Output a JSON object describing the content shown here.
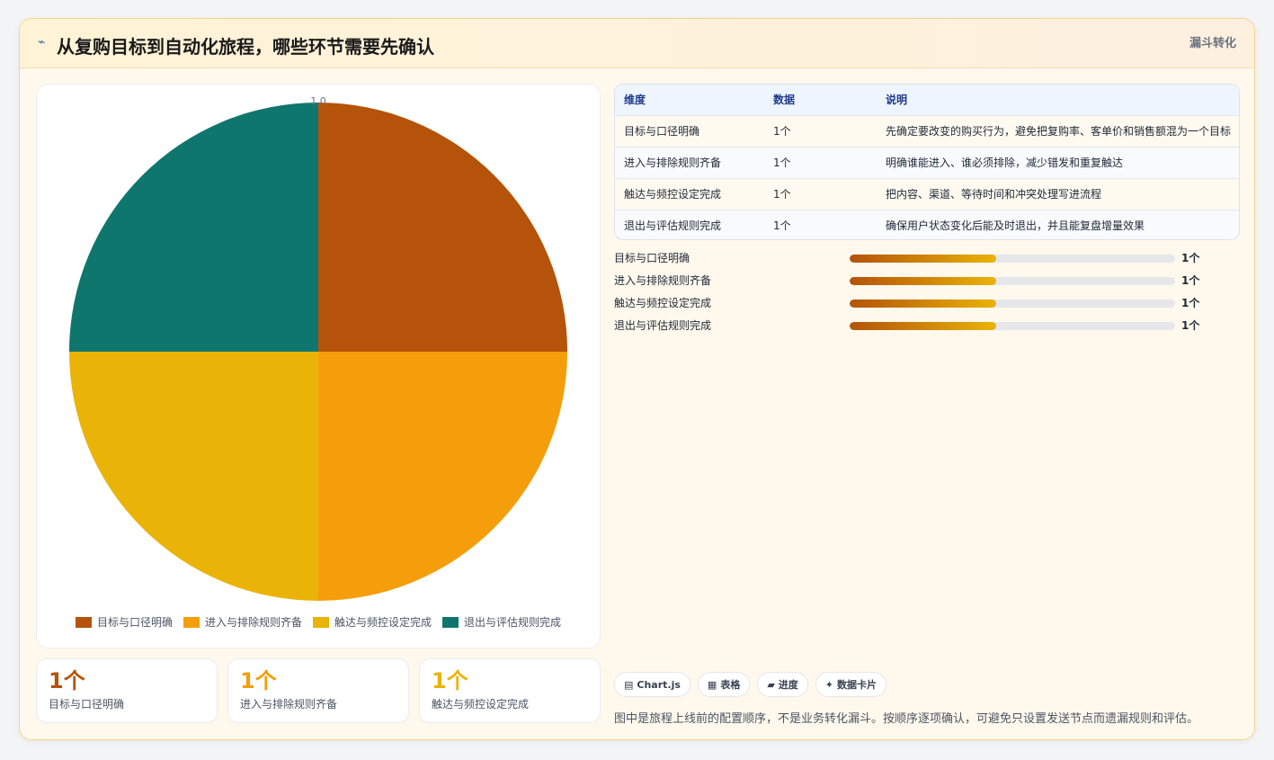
{
  "header": {
    "icon": "bolt-icon",
    "title": "从复购目标到自动化旅程，哪些环节需要先确认",
    "tag": "漏斗转化"
  },
  "chart_data": {
    "type": "pie",
    "categories": [
      "目标与口径明确",
      "进入与排除规则齐备",
      "触达与频控设定完成",
      "退出与评估规则完成"
    ],
    "values": [
      1,
      1,
      1,
      1
    ],
    "colors": [
      "#b45309",
      "#f59e0b",
      "#eab308",
      "#0f766e"
    ],
    "top_label": "1.0",
    "legend_position": "bottom"
  },
  "kpis": [
    {
      "value": "1个",
      "label": "目标与口径明确",
      "color": "#b45309"
    },
    {
      "value": "1个",
      "label": "进入与排除规则齐备",
      "color": "#f59e0b"
    },
    {
      "value": "1个",
      "label": "触达与频控设定完成",
      "color": "#eab308"
    }
  ],
  "table": {
    "headers": [
      "维度",
      "数据",
      "说明"
    ],
    "rows": [
      [
        "目标与口径明确",
        "1个",
        "先确定要改变的购买行为，避免把复购率、客单价和销售额混为一个目标"
      ],
      [
        "进入与排除规则齐备",
        "1个",
        "明确谁能进入、谁必须排除，减少错发和重复触达"
      ],
      [
        "触达与频控设定完成",
        "1个",
        "把内容、渠道、等待时间和冲突处理写进流程"
      ],
      [
        "退出与评估规则完成",
        "1个",
        "确保用户状态变化后能及时退出，并且能复盘增量效果"
      ]
    ]
  },
  "progress": [
    {
      "label": "目标与口径明确",
      "value": "1个",
      "fraction": 0.45
    },
    {
      "label": "进入与排除规则齐备",
      "value": "1个",
      "fraction": 0.45
    },
    {
      "label": "触达与频控设定完成",
      "value": "1个",
      "fraction": 0.45
    },
    {
      "label": "退出与评估规则完成",
      "value": "1个",
      "fraction": 0.45
    }
  ],
  "chips": [
    {
      "icon": "▤",
      "label": "Chart.js"
    },
    {
      "icon": "▦",
      "label": "表格"
    },
    {
      "icon": "▰",
      "label": "进度"
    },
    {
      "icon": "✦",
      "label": "数据卡片"
    }
  ],
  "note": "图中是旅程上线前的配置顺序，不是业务转化漏斗。按顺序逐项确认，可避免只设置发送节点而遗漏规则和评估。"
}
